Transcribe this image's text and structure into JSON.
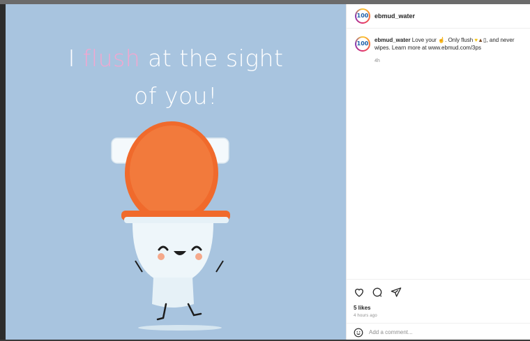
{
  "media": {
    "headline_part1": "I ",
    "headline_highlight": "flush",
    "headline_part2": " at the sight",
    "headline_line2": "of you!",
    "highlight_color": "#f2a7d0",
    "background_color": "#a8c4df",
    "toilet_lid_color": "#f06a2c"
  },
  "header": {
    "avatar_text": "100",
    "username": "ebmud_water"
  },
  "comment": {
    "avatar_text": "100",
    "username": "ebmud_water",
    "text_a": " Love your ",
    "text_b": ". Only flush ",
    "text_c": ", and never",
    "text_line2": "wipes. Learn more at www.ebmud.com/3ps",
    "time": "4h"
  },
  "actions": {
    "likes": "5 likes",
    "time_ago": "4 hours ago"
  },
  "add_comment": {
    "placeholder": "Add a comment..."
  }
}
